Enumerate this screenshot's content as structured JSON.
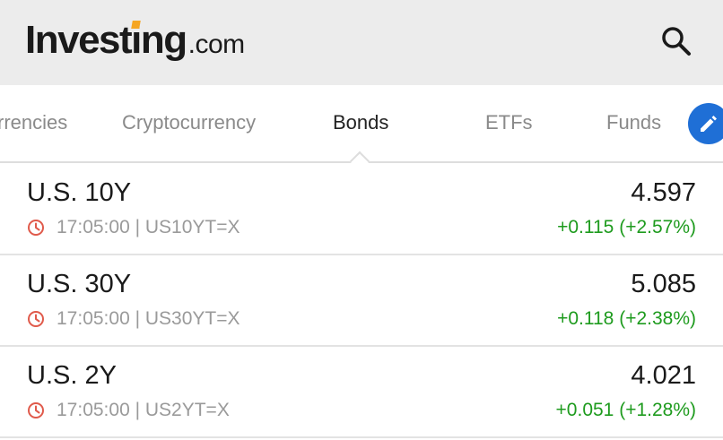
{
  "header": {
    "logo_main": "Investing",
    "logo_suffix": ".com",
    "search_icon": "search-icon"
  },
  "tabs": [
    {
      "label": "rrencies",
      "active": false
    },
    {
      "label": "Cryptocurrency",
      "active": false
    },
    {
      "label": "Bonds",
      "active": true
    },
    {
      "label": "ETFs",
      "active": false
    },
    {
      "label": "Funds",
      "active": false
    }
  ],
  "edit_icon": "pencil-icon",
  "rows": [
    {
      "name": "U.S. 10Y",
      "time": "17:05:00",
      "symbol": "US10YT=X",
      "price": "4.597",
      "change": "+0.115 (+2.57%)"
    },
    {
      "name": "U.S. 30Y",
      "time": "17:05:00",
      "symbol": "US30YT=X",
      "price": "5.085",
      "change": "+0.118 (+2.38%)"
    },
    {
      "name": "U.S. 2Y",
      "time": "17:05:00",
      "symbol": "US2YT=X",
      "price": "4.021",
      "change": "+0.051 (+1.28%)"
    }
  ],
  "colors": {
    "accent": "#1f6fd6",
    "positive": "#1e9b1e",
    "clock": "#e05a4b",
    "logo_dot": "#f5a623"
  }
}
